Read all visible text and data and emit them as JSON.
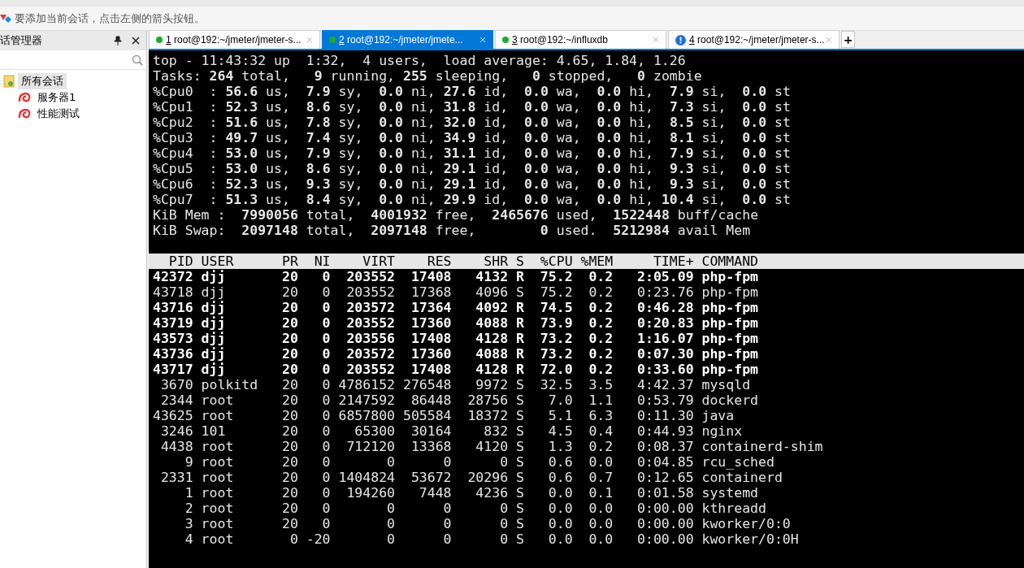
{
  "hint_bar": {
    "text": "要添加当前会话，点击左侧的箭头按钮。"
  },
  "sidebar": {
    "title": "话管理器",
    "tree": [
      {
        "label": "所有会话",
        "selected": true,
        "children": [
          {
            "label": "服务器1",
            "selected": false
          },
          {
            "label": "性能测试",
            "selected": false
          }
        ]
      }
    ]
  },
  "tabs": [
    {
      "number": "1",
      "label": "root@192:~/jmeter/jmeter-s...",
      "alert": false,
      "selected": false
    },
    {
      "number": "2",
      "label": "root@192:~/jmeter/jmete...",
      "alert": false,
      "selected": true
    },
    {
      "number": "3",
      "label": "root@192:~/influxdb",
      "alert": false,
      "selected": false
    },
    {
      "number": "4",
      "label": "root@192:~/jmeter/jmeter-s...",
      "alert": true,
      "selected": false
    }
  ],
  "new_tab": "+",
  "terminal": {
    "summary": [
      "top - 11:43:32 up  1:32,  4 users,  load average: 4.65, 1.84, 1.26",
      "Tasks: **264** total,   **9** running, **255** sleeping,   **0** stopped,   **0** zombie",
      "%Cpu0  : **56.6** us,  **7.9** sy,  **0.0** ni, **27.6** id,  **0.0** wa,  **0.0** hi,  **7.9** si,  **0.0** st",
      "%Cpu1  : **52.3** us,  **8.6** sy,  **0.0** ni, **31.8** id,  **0.0** wa,  **0.0** hi,  **7.3** si,  **0.0** st",
      "%Cpu2  : **51.6** us,  **7.8** sy,  **0.0** ni, **32.0** id,  **0.0** wa,  **0.0** hi,  **8.5** si,  **0.0** st",
      "%Cpu3  : **49.7** us,  **7.4** sy,  **0.0** ni, **34.9** id,  **0.0** wa,  **0.0** hi,  **8.1** si,  **0.0** st",
      "%Cpu4  : **53.0** us,  **7.9** sy,  **0.0** ni, **31.1** id,  **0.0** wa,  **0.0** hi,  **7.9** si,  **0.0** st",
      "%Cpu5  : **53.0** us,  **8.6** sy,  **0.0** ni, **29.1** id,  **0.0** wa,  **0.0** hi,  **9.3** si,  **0.0** st",
      "%Cpu6  : **52.3** us,  **9.3** sy,  **0.0** ni, **29.1** id,  **0.0** wa,  **0.0** hi,  **9.3** si,  **0.0** st",
      "%Cpu7  : **51.3** us,  **8.4** sy,  **0.0** ni, **29.9** id,  **0.0** wa,  **0.0** hi, **10.4** si,  **0.0** st",
      "KiB Mem :  **7990056** total,  **4001932** free,  **2465676** used,  **1522448** buff/cache",
      "KiB Swap:  **2097148** total,  **2097148** free,        **0** used.  **5212984** avail Mem"
    ],
    "columns": [
      "PID",
      "USER",
      "PR",
      "NI",
      "VIRT",
      "RES",
      "SHR",
      "S",
      "%CPU",
      "%MEM",
      "TIME+",
      "COMMAND"
    ],
    "processes": [
      {
        "cells": [
          "42372",
          "djj",
          "20",
          "0",
          "203552",
          "17408",
          "4132",
          "R",
          "75.2",
          "0.2",
          "2:05.09",
          "php-fpm"
        ],
        "bold": true
      },
      {
        "cells": [
          "43718",
          "djj",
          "20",
          "0",
          "203552",
          "17368",
          "4096",
          "S",
          "75.2",
          "0.2",
          "0:23.76",
          "php-fpm"
        ],
        "bold": false
      },
      {
        "cells": [
          "43716",
          "djj",
          "20",
          "0",
          "203572",
          "17364",
          "4092",
          "R",
          "74.5",
          "0.2",
          "0:46.28",
          "php-fpm"
        ],
        "bold": true
      },
      {
        "cells": [
          "43719",
          "djj",
          "20",
          "0",
          "203552",
          "17360",
          "4088",
          "R",
          "73.9",
          "0.2",
          "0:20.83",
          "php-fpm"
        ],
        "bold": true
      },
      {
        "cells": [
          "43573",
          "djj",
          "20",
          "0",
          "203556",
          "17408",
          "4128",
          "R",
          "73.2",
          "0.2",
          "1:16.07",
          "php-fpm"
        ],
        "bold": true
      },
      {
        "cells": [
          "43736",
          "djj",
          "20",
          "0",
          "203572",
          "17360",
          "4088",
          "R",
          "73.2",
          "0.2",
          "0:07.30",
          "php-fpm"
        ],
        "bold": true
      },
      {
        "cells": [
          "43717",
          "djj",
          "20",
          "0",
          "203552",
          "17408",
          "4128",
          "R",
          "72.0",
          "0.2",
          "0:33.60",
          "php-fpm"
        ],
        "bold": true
      },
      {
        "cells": [
          "3670",
          "polkitd",
          "20",
          "0",
          "4786152",
          "276548",
          "9972",
          "S",
          "32.5",
          "3.5",
          "4:42.37",
          "mysqld"
        ],
        "bold": false
      },
      {
        "cells": [
          "2344",
          "root",
          "20",
          "0",
          "2147592",
          "86448",
          "28756",
          "S",
          "7.0",
          "1.1",
          "0:53.79",
          "dockerd"
        ],
        "bold": false
      },
      {
        "cells": [
          "43625",
          "root",
          "20",
          "0",
          "6857800",
          "505584",
          "18372",
          "S",
          "5.1",
          "6.3",
          "0:11.30",
          "java"
        ],
        "bold": false
      },
      {
        "cells": [
          "3246",
          "101",
          "20",
          "0",
          "65300",
          "30164",
          "832",
          "S",
          "4.5",
          "0.4",
          "0:44.93",
          "nginx"
        ],
        "bold": false
      },
      {
        "cells": [
          "4438",
          "root",
          "20",
          "0",
          "712120",
          "13368",
          "4120",
          "S",
          "1.3",
          "0.2",
          "0:08.37",
          "containerd-shim"
        ],
        "bold": false
      },
      {
        "cells": [
          "9",
          "root",
          "20",
          "0",
          "0",
          "0",
          "0",
          "S",
          "0.6",
          "0.0",
          "0:04.85",
          "rcu_sched"
        ],
        "bold": false
      },
      {
        "cells": [
          "2331",
          "root",
          "20",
          "0",
          "1404824",
          "53672",
          "20296",
          "S",
          "0.6",
          "0.7",
          "0:12.65",
          "containerd"
        ],
        "bold": false
      },
      {
        "cells": [
          "1",
          "root",
          "20",
          "0",
          "194260",
          "7448",
          "4236",
          "S",
          "0.0",
          "0.1",
          "0:01.58",
          "systemd"
        ],
        "bold": false
      },
      {
        "cells": [
          "2",
          "root",
          "20",
          "0",
          "0",
          "0",
          "0",
          "S",
          "0.0",
          "0.0",
          "0:00.00",
          "kthreadd"
        ],
        "bold": false
      },
      {
        "cells": [
          "3",
          "root",
          "20",
          "0",
          "0",
          "0",
          "0",
          "S",
          "0.0",
          "0.0",
          "0:00.00",
          "kworker/0:0"
        ],
        "bold": false
      },
      {
        "cells": [
          "4",
          "root",
          "0",
          "-20",
          "0",
          "0",
          "0",
          "S",
          "0.0",
          "0.0",
          "0:00.00",
          "kworker/0:0H"
        ],
        "bold": false
      }
    ]
  }
}
